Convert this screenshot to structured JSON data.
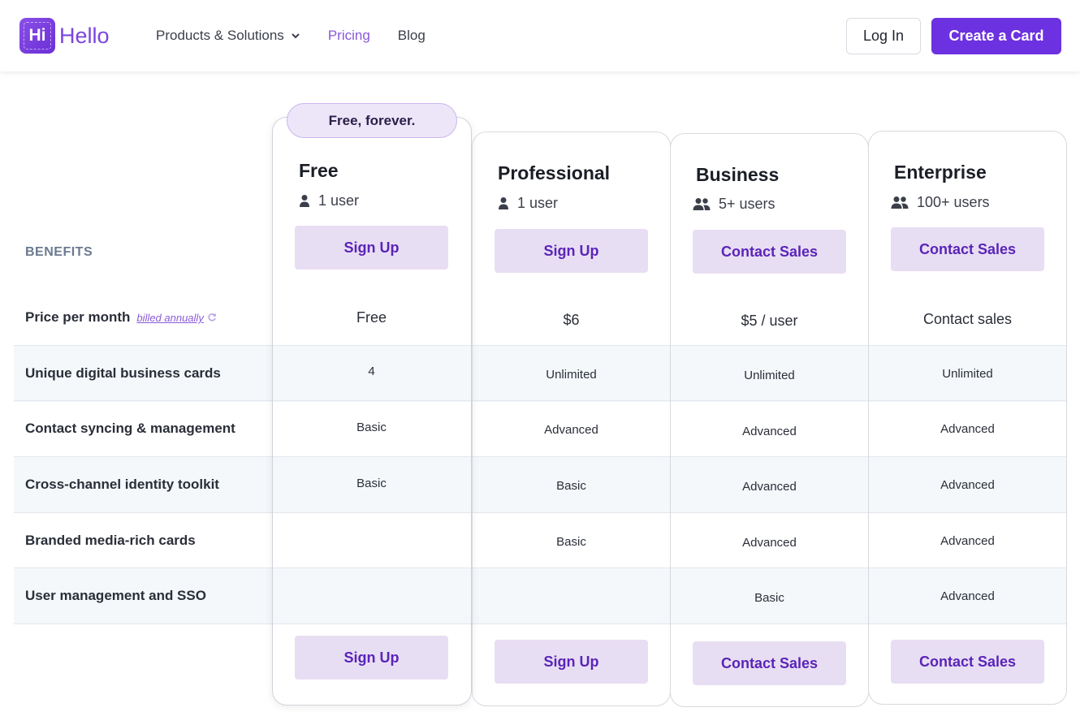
{
  "header": {
    "logo_mark": "Hi",
    "logo_text": "Hello",
    "nav": [
      "Products & Solutions",
      "Pricing",
      "Blog"
    ],
    "login_label": "Log In",
    "create_label": "Create a Card"
  },
  "table": {
    "benefits_label": "BENEFITS",
    "badge": "Free, forever.",
    "billed_annually": "billed annually",
    "rows": [
      "Price per month",
      "Unique digital business cards",
      "Contact syncing & management",
      "Cross-channel identity toolkit",
      "Branded media-rich cards",
      "User management and SSO"
    ],
    "plans": [
      {
        "name": "Free",
        "users": "1 user",
        "cta": "Sign Up",
        "values": [
          "Free",
          "4",
          "Basic",
          "Basic",
          "",
          ""
        ]
      },
      {
        "name": "Professional",
        "users": "1 user",
        "cta": "Sign Up",
        "values": [
          "$6",
          "Unlimited",
          "Advanced",
          "Basic",
          "Basic",
          ""
        ]
      },
      {
        "name": "Business",
        "users": "5+ users",
        "cta": "Contact Sales",
        "values": [
          "$5 / user",
          "Unlimited",
          "Advanced",
          "Advanced",
          "Advanced",
          "Basic"
        ]
      },
      {
        "name": "Enterprise",
        "users": "100+ users",
        "cta": "Contact Sales",
        "values": [
          "Contact sales",
          "Unlimited",
          "Advanced",
          "Advanced",
          "Advanced",
          "Advanced"
        ]
      }
    ]
  }
}
